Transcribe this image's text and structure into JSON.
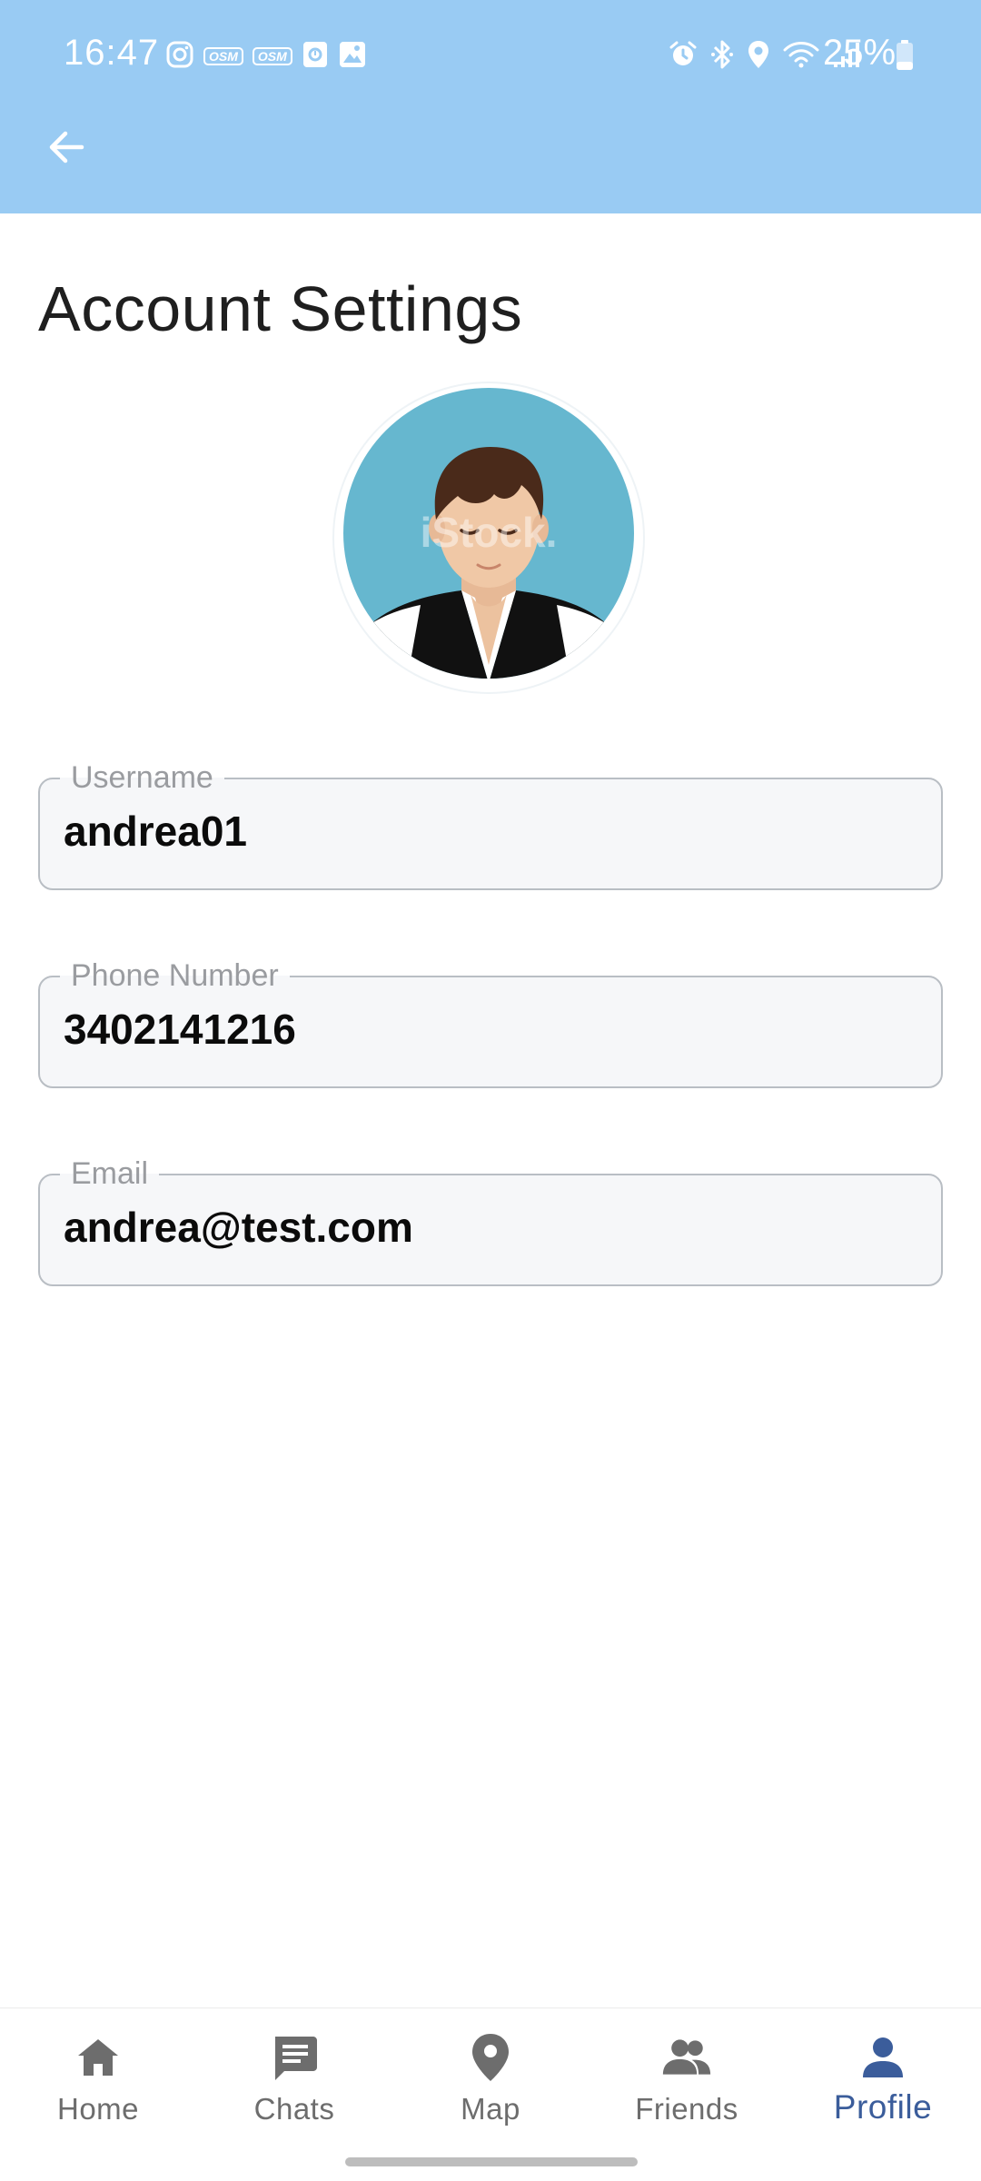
{
  "status_bar": {
    "time": "16:47",
    "battery": "25%",
    "left_icons": [
      "instagram-icon",
      "osm-icon",
      "osm-icon",
      "notification-app-icon",
      "image-icon"
    ],
    "osm_label": "OSM",
    "right_icons": [
      "alarm-icon",
      "bluetooth-icon",
      "location-icon",
      "wifi-icon",
      "signal-icon",
      "battery-icon"
    ]
  },
  "app_bar": {
    "back_icon": "arrow-back-icon",
    "color": "#99cbf3"
  },
  "page": {
    "title": "Account Settings"
  },
  "avatar": {
    "watermark": "iStock."
  },
  "form": {
    "username": {
      "label": "Username",
      "value": "andrea01"
    },
    "phone": {
      "label": "Phone Number",
      "value": "3402141216"
    },
    "email": {
      "label": "Email",
      "value": "andrea@test.com"
    }
  },
  "bottom_nav": {
    "active_color": "#3b5d9b",
    "items": [
      {
        "label": "Home",
        "icon": "home-icon"
      },
      {
        "label": "Chats",
        "icon": "chat-icon"
      },
      {
        "label": "Map",
        "icon": "map-pin-icon"
      },
      {
        "label": "Friends",
        "icon": "people-icon"
      },
      {
        "label": "Profile",
        "icon": "person-icon",
        "active": true
      }
    ]
  }
}
